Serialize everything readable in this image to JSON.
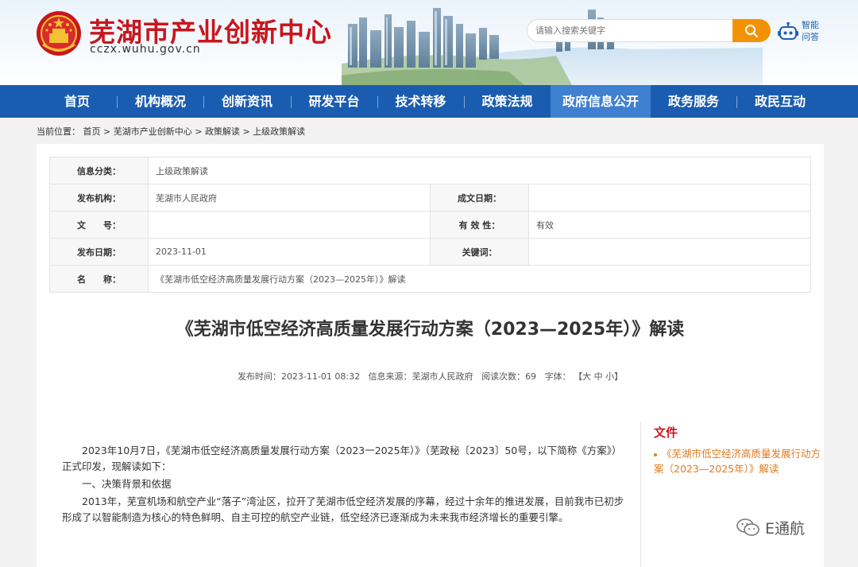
{
  "header": {
    "site_title": "芜湖市产业创新中心",
    "site_url": "cczx.wuhu.gov.cn",
    "search_placeholder": "请输入搜索关键字",
    "ai_label_line1": "智能",
    "ai_label_line2": "问答"
  },
  "nav": {
    "items": [
      {
        "label": "首页"
      },
      {
        "label": "机构概况"
      },
      {
        "label": "创新资讯"
      },
      {
        "label": "研发平台"
      },
      {
        "label": "技术转移"
      },
      {
        "label": "政策法规"
      },
      {
        "label": "政府信息公开",
        "active": true
      },
      {
        "label": "政务服务"
      },
      {
        "label": "政民互动"
      }
    ]
  },
  "breadcrumb": {
    "prefix": "当前位置：",
    "items": [
      "首页",
      "芜湖市产业创新中心",
      "政策解读",
      "上级政策解读"
    ],
    "separator": ">"
  },
  "info_table": {
    "category_label": "信息分类：",
    "category_value": "上级政策解读",
    "issuer_label": "发布机构：",
    "issuer_value": "芜湖市人民政府",
    "date_written_label": "成文日期：",
    "date_written_value": "",
    "doc_no_label": "文　　号：",
    "doc_no_value": "",
    "validity_label": "有 效 性：",
    "validity_value": "有效",
    "publish_date_label": "发布日期：",
    "publish_date_value": "2023-11-01",
    "keywords_label": "关键词：",
    "keywords_value": "",
    "name_label": "名　　称：",
    "name_value": "《芜湖市低空经济高质量发展行动方案（2023—2025年）》解读"
  },
  "article": {
    "title": "《芜湖市低空经济高质量发展行动方案（2023—2025年）》解读",
    "meta_time_label": "发布时间：",
    "meta_time": "2023-11-01 08:32",
    "meta_source_label": "信息来源：",
    "meta_source": "芜湖市人民政府",
    "meta_views_label": "阅读次数：",
    "meta_views": "69",
    "meta_font_label": "字体：",
    "font_open": "【",
    "font_large": "大",
    "font_medium": "中",
    "font_small": "小",
    "font_close": "】",
    "paragraph1": "2023年10月7日，《芜湖市低空经济高质量发展行动方案（2023一2025年）》（芜政秘〔2023〕50号，以下简称《方案》）正式印发，现解读如下：",
    "paragraph2": "一、决策背景和依据",
    "paragraph3": "2013年，芜宣机场和航空产业“落子”湾沚区，拉开了芜湖市低空经济发展的序幕，经过十余年的推进发展，目前我市已初步形成了以智能制造为核心的特色鲜明、自主可控的航空产业链，低空经济已逐渐成为未来我市经济增长的重要引擎。"
  },
  "sidebar": {
    "heading": "文件",
    "link": "《芜湖市低空经济高质量发展行动方案（2023—2025年）》解读"
  },
  "watermark": {
    "text": "E通航"
  },
  "colors": {
    "nav_bg": "#1a5cb0",
    "nav_active": "#3f80d0",
    "title_red": "#c8161d",
    "search_orange": "#f39200",
    "sidebar_link": "#e07a1f"
  }
}
